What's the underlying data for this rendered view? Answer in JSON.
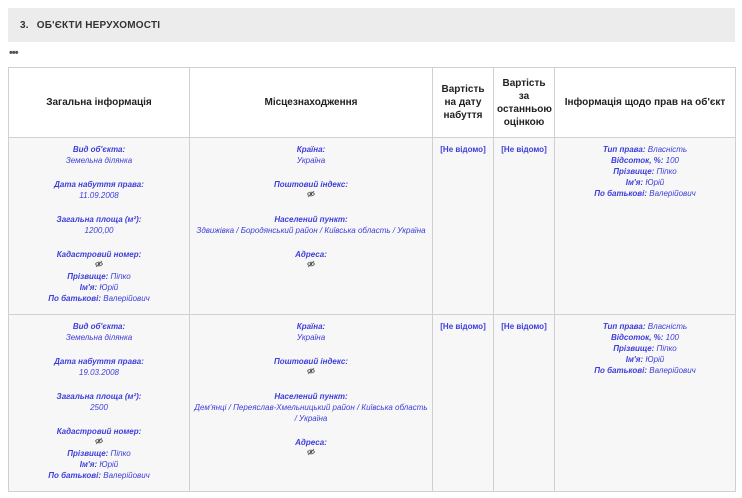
{
  "section": {
    "number": "3.",
    "title": "ОБ'ЄКТИ НЕРУХОМОСТІ",
    "more": "•••"
  },
  "table": {
    "headers": [
      "Загальна інформація",
      "Місцезнаходження",
      "Вартість на дату набуття",
      "Вартість за останньою оцінкою",
      "Інформація щодо прав на об'єкт"
    ],
    "labels": {
      "type": "Вид об'єкта:",
      "acq_date": "Дата набуття права:",
      "area": "Загальна площа (м²):",
      "cadastral": "Кадастровий номер:",
      "surname": "Прізвище:",
      "name": "Ім'я:",
      "patronymic": "По батькові:",
      "country": "Країна:",
      "postal": "Поштовий індекс:",
      "settlement": "Населений пункт:",
      "address": "Адреса:",
      "right_type": "Тип права:",
      "percent": "Відсоток, %:"
    },
    "rows": [
      {
        "type": "Земельна ділянка",
        "acq_date": "11.09.2008",
        "area": "1200,00",
        "surname": "Піпко",
        "name": "Юрій",
        "patronymic": "Валерійович",
        "country": "Україна",
        "settlement": "Здвижівка / Бородянський район / Київська область / Україна",
        "value_acq": "[Не відомо]",
        "value_last": "[Не відомо]",
        "right_type": "Власність",
        "percent": "100",
        "r_surname": "Піпко",
        "r_name": "Юрій",
        "r_patronymic": "Валерійович"
      },
      {
        "type": "Земельна ділянка",
        "acq_date": "19.03.2008",
        "area": "2500",
        "surname": "Піпко",
        "name": "Юрій",
        "patronymic": "Валерійович",
        "country": "Україна",
        "settlement": "Дем'янці / Переяслав-Хмельницький район / Київська область / Україна",
        "value_acq": "[Не відомо]",
        "value_last": "[Не відомо]",
        "right_type": "Власність",
        "percent": "100",
        "r_surname": "Піпко",
        "r_name": "Юрій",
        "r_patronymic": "Валерійович"
      }
    ],
    "icon": "hidden-eye-icon"
  }
}
